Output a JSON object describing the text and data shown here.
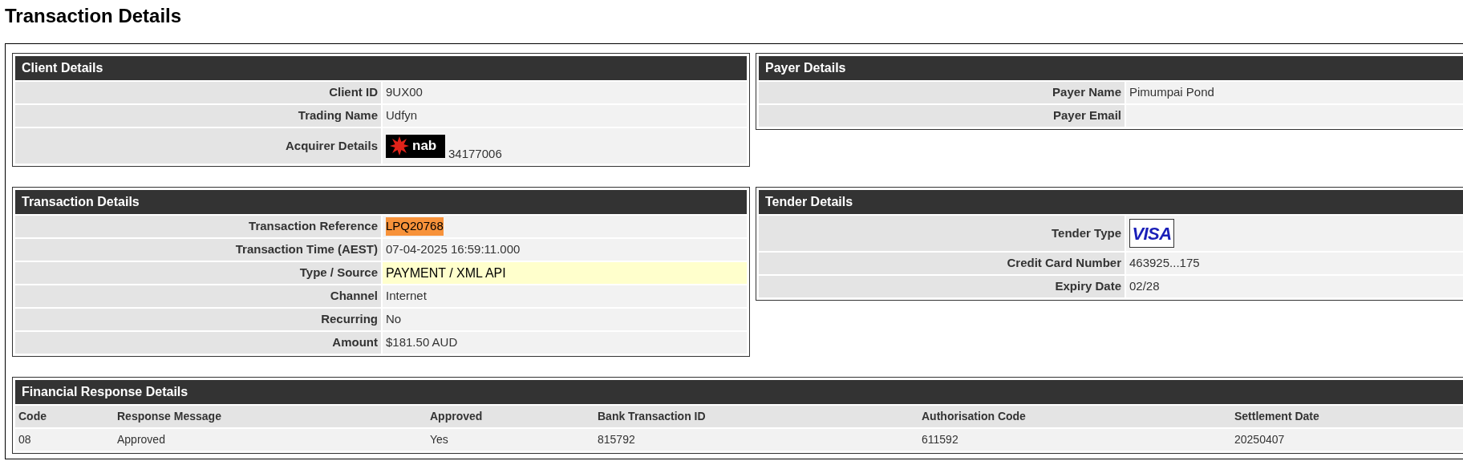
{
  "page_title": "Transaction Details",
  "client_details": {
    "title": "Client Details",
    "rows": [
      {
        "label": "Client ID",
        "value": "9UX00"
      },
      {
        "label": "Trading Name",
        "value": "Udfyn"
      },
      {
        "label": "Acquirer Details",
        "value": "34177006",
        "logo": {
          "kind": "bank",
          "text": "nab"
        }
      }
    ]
  },
  "payer_details": {
    "title": "Payer Details",
    "rows": [
      {
        "label": "Payer Name",
        "value": "Pimumpai Pond"
      },
      {
        "label": "Payer Email"
      }
    ]
  },
  "transaction_details": {
    "title": "Transaction Details",
    "rows": [
      {
        "label": "Transaction Reference",
        "value": "LPQ20768",
        "highlighted": true
      },
      {
        "label": "Transaction Time (AEST)",
        "value": "07-04-2025 16:59:11.000"
      },
      {
        "label": "Type / Source",
        "value": "PAYMENT / XML API",
        "notice": true
      },
      {
        "label": "Channel",
        "value": "Internet"
      },
      {
        "label": "Recurring",
        "value": "No"
      },
      {
        "label": "Amount",
        "value": "$181.50 AUD"
      }
    ]
  },
  "tender_details": {
    "title": "Tender Details",
    "rows": [
      {
        "label": "Tender Type",
        "logo": {
          "kind": "card",
          "text": "VISA"
        }
      },
      {
        "label": "Credit Card Number",
        "value": "463925...175"
      },
      {
        "label": "Expiry Date",
        "value": "02/28"
      }
    ]
  },
  "financial_response_details": {
    "title": "Financial Response Details",
    "columns": [
      "Code",
      "Response Message",
      "Approved",
      "Bank Transaction ID",
      "Authorisation Code",
      "Settlement Date"
    ],
    "rows": [
      [
        "08",
        "Approved",
        "Yes",
        "815792",
        "611592",
        "20250407"
      ]
    ]
  }
}
